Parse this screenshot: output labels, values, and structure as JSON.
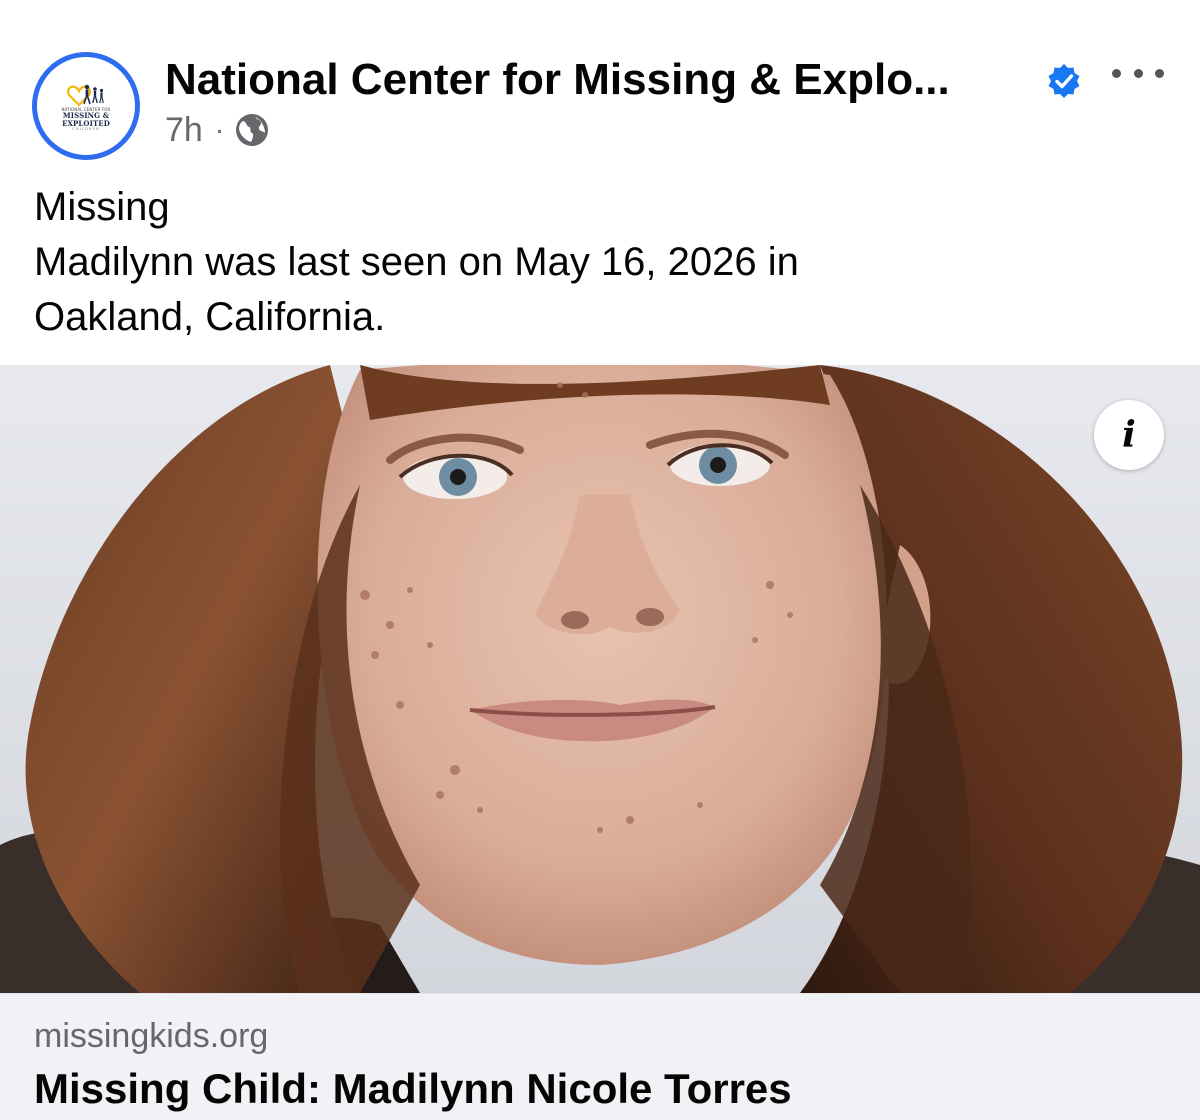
{
  "post": {
    "author": {
      "name": "National Center for Missing & Explo...",
      "verified": true,
      "avatar_logo": {
        "line1": "NATIONAL CENTER FOR",
        "line2": "MISSING &",
        "line3": "EXPLOITED",
        "line4": "CHILDREN",
        "accent_color": "#f2b705",
        "border_color": "#2f6df0"
      }
    },
    "timestamp": "7h",
    "separator": "·",
    "audience_icon": "globe-icon",
    "more_icon": "more-options-icon",
    "text": {
      "line1": "Missing",
      "line2": "Madilynn was last seen on May 16, 2026 in",
      "line3": "Oakland, California."
    }
  },
  "media": {
    "info_icon": "info-icon",
    "info_glyph": "i"
  },
  "link_preview": {
    "domain": "missingkids.org",
    "title": "Missing Child: Madilynn Nicole Torres"
  },
  "colors": {
    "verified_badge": "#1877f2",
    "secondary_text": "#65676b",
    "preview_background": "#f0f2f5"
  }
}
